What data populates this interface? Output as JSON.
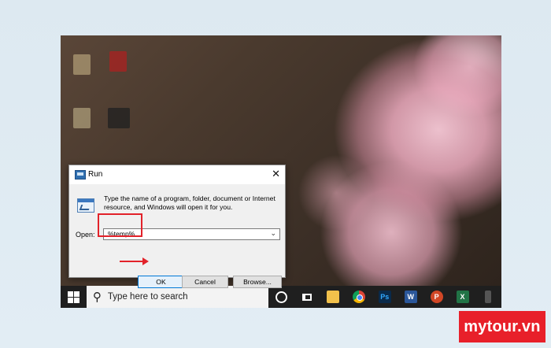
{
  "run_dialog": {
    "title": "Run",
    "close_glyph": "✕",
    "description": "Type the name of a program, folder, document or Internet resource, and Windows will open it for you.",
    "open_label": "Open:",
    "open_value": "%temp%",
    "ok_label": "OK",
    "cancel_label": "Cancel",
    "browse_label": "Browse..."
  },
  "taskbar": {
    "search_placeholder": "Type here to search",
    "apps": [
      "cortana-icon",
      "task-view-icon",
      "file-explorer-icon",
      "chrome-icon",
      "photoshop-icon",
      "word-icon",
      "powerpoint-icon",
      "excel-icon"
    ]
  },
  "annotation_colors": {
    "highlight": "#e2222a"
  },
  "watermark": {
    "text": "mytour.vn",
    "color": "#e8202a"
  }
}
